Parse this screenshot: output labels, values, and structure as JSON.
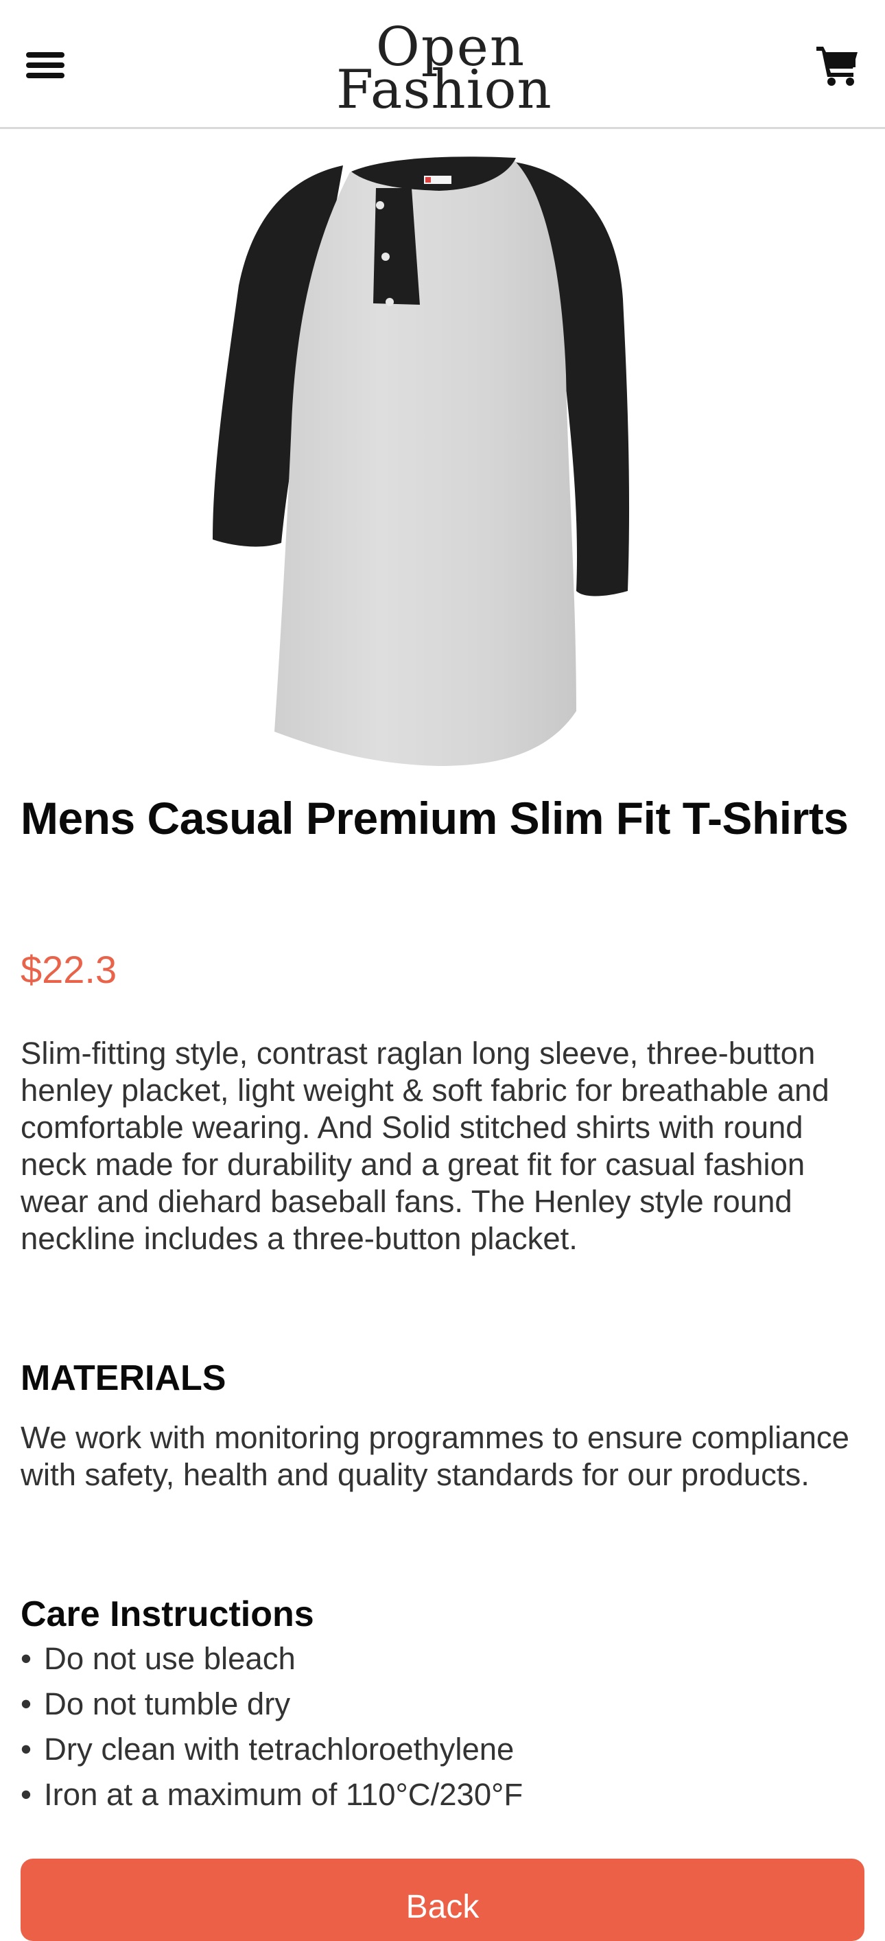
{
  "header": {
    "menu_icon": "hamburger-menu-icon",
    "logo_line1": "Open",
    "logo_line2": "Fashion",
    "cart_icon": "shopping-cart-icon"
  },
  "product": {
    "image_alt": "raglan-henley-shirt-image",
    "title": "Mens Casual Premium Slim Fit T-Shirts",
    "price": "$22.3",
    "description": "Slim-fitting style, contrast raglan long sleeve, three-button henley placket, light weight & soft fabric for breathable and comfortable wearing. And Solid stitched shirts with round neck made for durability and a great fit for casual fashion wear and diehard baseball fans. The Henley style round neckline includes a three-button placket."
  },
  "materials": {
    "heading": "MATERIALS",
    "text": "We work with monitoring programmes to ensure compliance with safety, health and quality standards for our products."
  },
  "care": {
    "heading": "Care Instructions",
    "items": [
      "Do not use bleach",
      "Do not tumble dry",
      "Dry clean with tetrachloroethylene",
      "Iron at a maximum of 110°C/230°F"
    ]
  },
  "actions": {
    "back_label": "Back"
  },
  "colors": {
    "accent": "#ec6048",
    "price": "#e8634a",
    "text": "#333333"
  }
}
